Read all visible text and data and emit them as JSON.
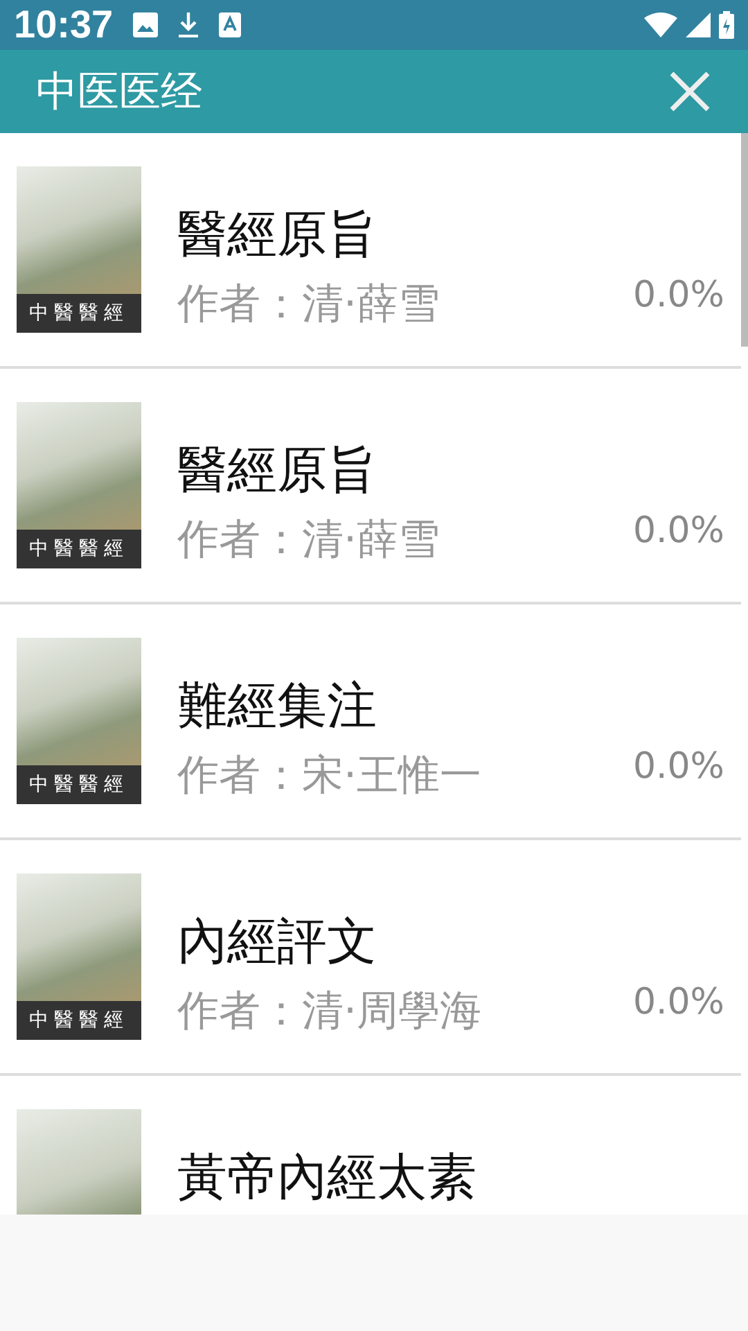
{
  "status_bar": {
    "time": "10:37"
  },
  "app_bar": {
    "title": "中医医经"
  },
  "books": [
    {
      "cover_label": "中醫醫經",
      "title": "醫經原旨",
      "author": "作者：清·薛雪",
      "progress": "0.0%"
    },
    {
      "cover_label": "中醫醫經",
      "title": "醫經原旨",
      "author": "作者：清·薛雪",
      "progress": "0.0%"
    },
    {
      "cover_label": "中醫醫經",
      "title": "難經集注",
      "author": "作者：宋·王惟一",
      "progress": "0.0%"
    },
    {
      "cover_label": "中醫醫經",
      "title": "內經評文",
      "author": "作者：清·周學海",
      "progress": "0.0%"
    },
    {
      "title": "黃帝內經太素"
    }
  ]
}
